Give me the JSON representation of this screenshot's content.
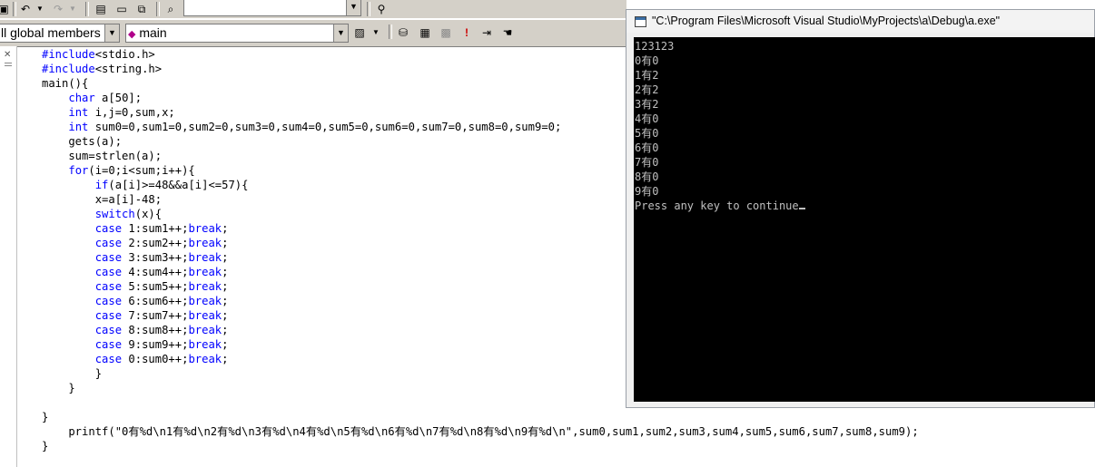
{
  "toolbar_top": {
    "search_value": ""
  },
  "toolbar_bottom": {
    "scope_combo": "ll global members",
    "function_combo": "main"
  },
  "editor": {
    "lines": [
      {
        "pre": "",
        "kw": "#include",
        "post": "<stdio.h>"
      },
      {
        "pre": "",
        "kw": "#include",
        "post": "<string.h>"
      },
      {
        "pre": "main(){",
        "kw": "",
        "post": ""
      },
      {
        "pre": "    ",
        "kw": "char",
        "post": " a[50];"
      },
      {
        "pre": "    ",
        "kw": "int",
        "post": " i,j=0,sum,x;"
      },
      {
        "pre": "    ",
        "kw": "int",
        "post": " sum0=0,sum1=0,sum2=0,sum3=0,sum4=0,sum5=0,sum6=0,sum7=0,sum8=0,sum9=0;"
      },
      {
        "pre": "    gets(a);",
        "kw": "",
        "post": ""
      },
      {
        "pre": "    sum=strlen(a);",
        "kw": "",
        "post": ""
      },
      {
        "pre": "    ",
        "kw": "for",
        "post": "(i=0;i<sum;i++){"
      },
      {
        "pre": "        ",
        "kw": "if",
        "post": "(a[i]>=48&&a[i]<=57){"
      },
      {
        "pre": "        x=a[i]-48;",
        "kw": "",
        "post": ""
      },
      {
        "pre": "        ",
        "kw": "switch",
        "post": "(x){"
      },
      {
        "pre": "        ",
        "kw": "case",
        "post": " 1:sum1++;",
        "kw2": "break",
        "post2": ";"
      },
      {
        "pre": "        ",
        "kw": "case",
        "post": " 2:sum2++;",
        "kw2": "break",
        "post2": ";"
      },
      {
        "pre": "        ",
        "kw": "case",
        "post": " 3:sum3++;",
        "kw2": "break",
        "post2": ";"
      },
      {
        "pre": "        ",
        "kw": "case",
        "post": " 4:sum4++;",
        "kw2": "break",
        "post2": ";"
      },
      {
        "pre": "        ",
        "kw": "case",
        "post": " 5:sum5++;",
        "kw2": "break",
        "post2": ";"
      },
      {
        "pre": "        ",
        "kw": "case",
        "post": " 6:sum6++;",
        "kw2": "break",
        "post2": ";"
      },
      {
        "pre": "        ",
        "kw": "case",
        "post": " 7:sum7++;",
        "kw2": "break",
        "post2": ";"
      },
      {
        "pre": "        ",
        "kw": "case",
        "post": " 8:sum8++;",
        "kw2": "break",
        "post2": ";"
      },
      {
        "pre": "        ",
        "kw": "case",
        "post": " 9:sum9++;",
        "kw2": "break",
        "post2": ";"
      },
      {
        "pre": "        ",
        "kw": "case",
        "post": " 0:sum0++;",
        "kw2": "break",
        "post2": ";"
      },
      {
        "pre": "        }",
        "kw": "",
        "post": ""
      },
      {
        "pre": "    }",
        "kw": "",
        "post": ""
      },
      {
        "pre": "",
        "kw": "",
        "post": ""
      },
      {
        "pre": "}",
        "kw": "",
        "post": ""
      },
      {
        "pre": "    printf(\"0有%d\\n1有%d\\n2有%d\\n3有%d\\n4有%d\\n5有%d\\n6有%d\\n7有%d\\n8有%d\\n9有%d\\n\",sum0,sum1,sum2,sum3,sum4,sum5,sum6,sum7,sum8,sum9);",
        "kw": "",
        "post": ""
      },
      {
        "pre": "}",
        "kw": "",
        "post": ""
      }
    ]
  },
  "console": {
    "title": "\"C:\\Program Files\\Microsoft Visual Studio\\MyProjects\\a\\Debug\\a.exe\"",
    "lines": [
      "123123",
      "0有0",
      "1有2",
      "2有2",
      "3有2",
      "4有0",
      "5有0",
      "6有0",
      "7有0",
      "8有0",
      "9有0"
    ],
    "prompt": "Press any key to continue"
  },
  "icons": [
    "undo-icon",
    "redo-icon",
    "workspace-icon",
    "output-icon",
    "windows-icon",
    "find-in-files-icon",
    "find-binoculars-icon",
    "class-wizard-icon",
    "compile-icon",
    "build-icon",
    "stop-build-icon",
    "execute-icon",
    "go-icon",
    "breakpoint-icon"
  ],
  "colors": {
    "keyword": "#0000ff",
    "console_bg": "#000000",
    "console_text": "#c0c0c0",
    "toolbar": "#d4d0c8"
  }
}
